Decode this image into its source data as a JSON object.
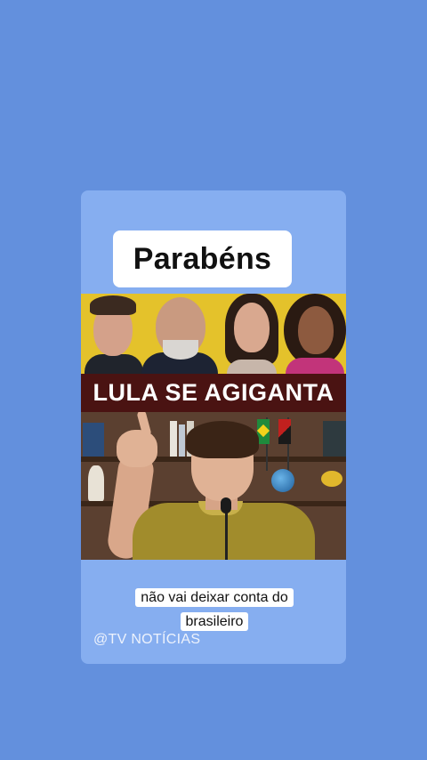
{
  "post": {
    "title": "Parabéns",
    "thumbnail": {
      "headline": "LULA SE AGIGANTA",
      "colors": {
        "top_bg": "#e4c22b",
        "banner_bg": "#4a1312",
        "shirt": "#a18c2c"
      },
      "flags": [
        "brazil-flag",
        "red-black-flag"
      ]
    },
    "caption": "não vai deixar conta do brasileiro",
    "watermark": "@TV NOTÍCIAS"
  },
  "colors": {
    "page_bg": "#6390dd",
    "card_bg": "#86aef0"
  }
}
